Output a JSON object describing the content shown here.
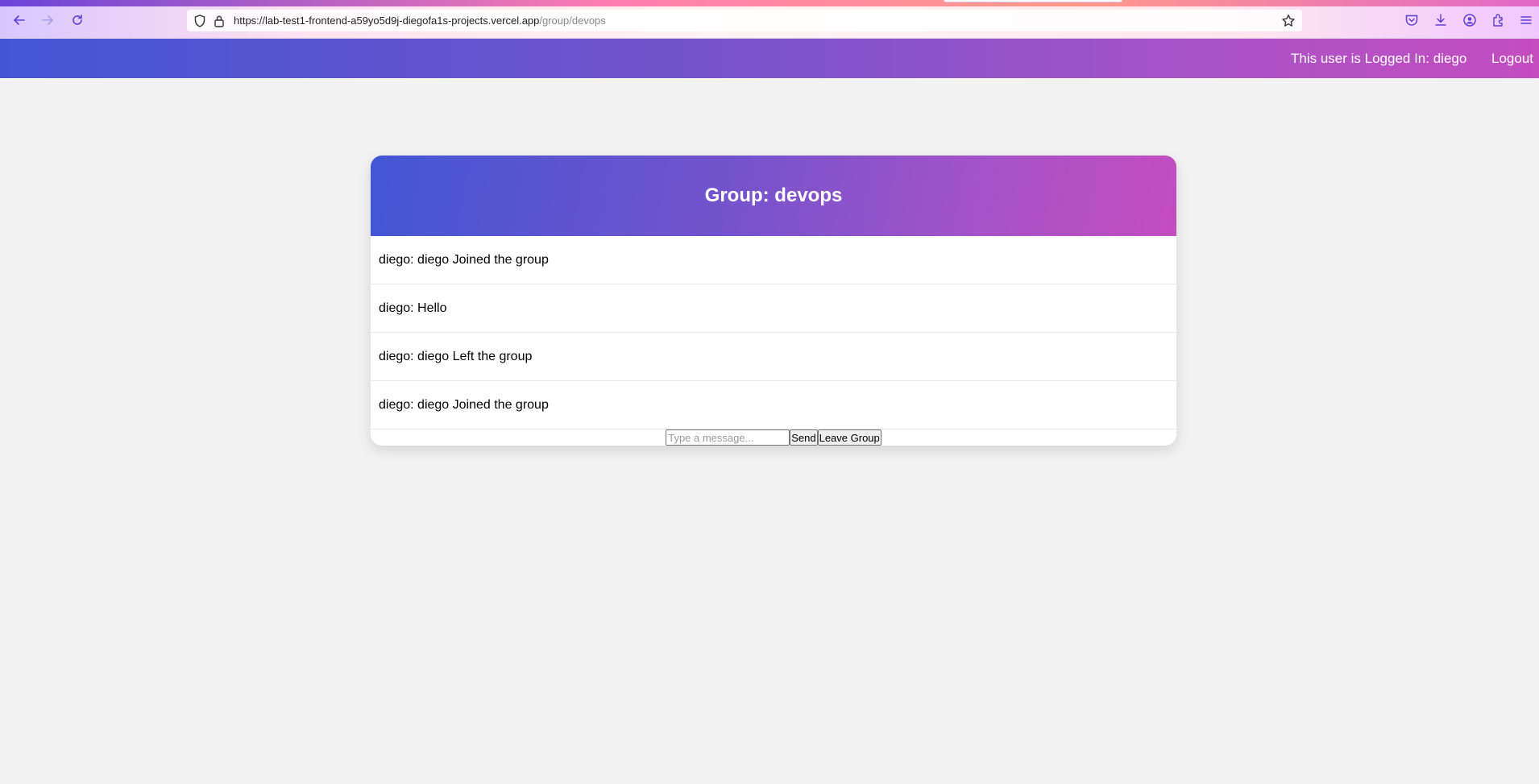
{
  "browser": {
    "url_host": "https://lab-test1-frontend-a59yo5d9j-diegofa1s-projects.vercel.app",
    "url_path": "/group/devops"
  },
  "navbar": {
    "logged_in_text": "This user is Logged In: diego",
    "logout_label": "Logout"
  },
  "group": {
    "title": "Group: devops",
    "messages": [
      "diego: diego Joined the group",
      "diego: Hello",
      "diego: diego Left the group",
      "diego: diego Joined the group"
    ],
    "composer": {
      "placeholder": "Type a message...",
      "send_label": "Send",
      "leave_label": "Leave Group"
    }
  }
}
